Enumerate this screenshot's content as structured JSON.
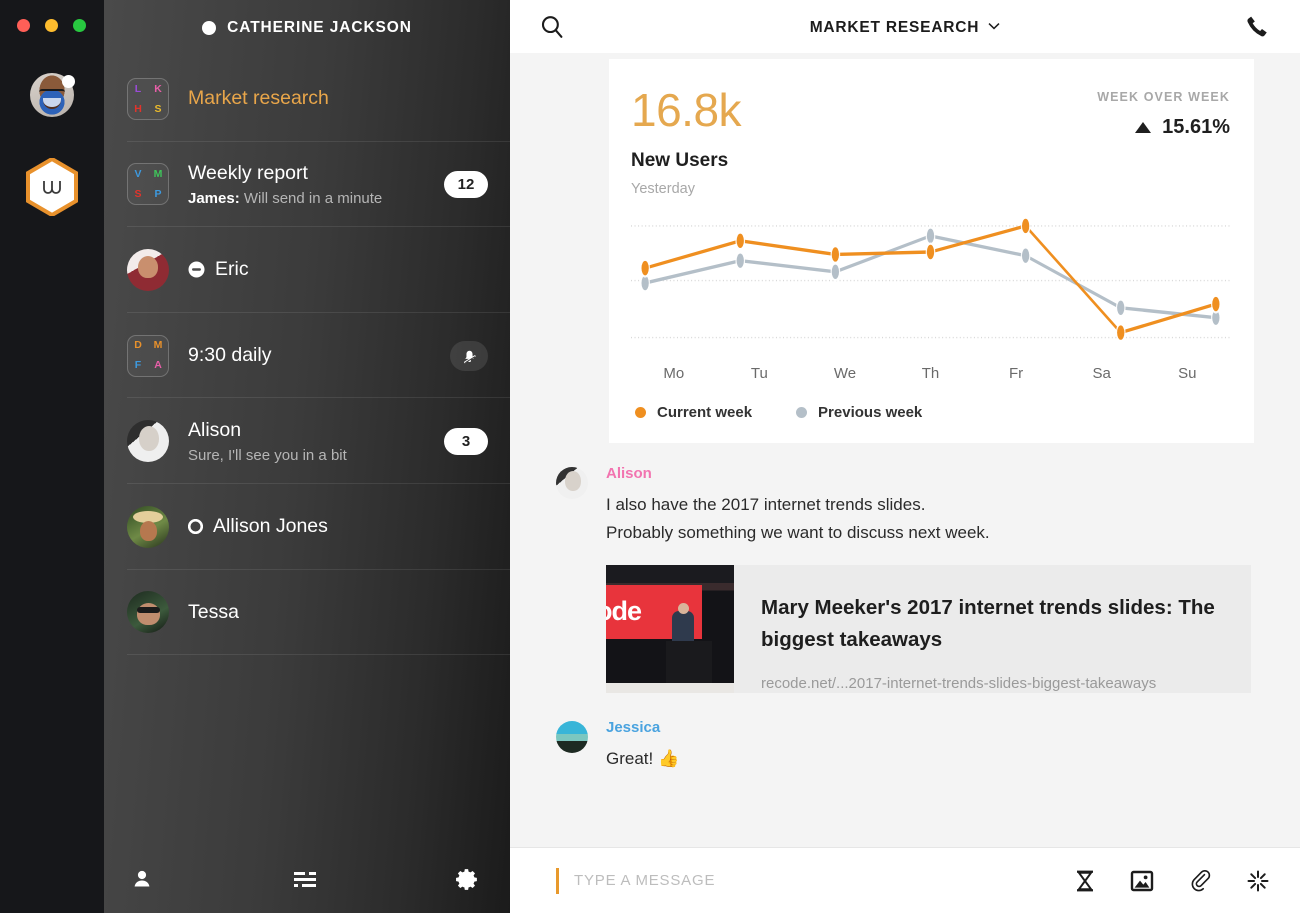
{
  "window": {
    "traffic_lights": [
      "close",
      "minimize",
      "zoom"
    ],
    "colors": {
      "close": "#ff5f57",
      "minimize": "#febc2e",
      "zoom": "#28c840"
    }
  },
  "rail": {
    "self_avatar_name": "self-avatar",
    "presence": "available",
    "app_logo": "wire-hexagon-logo",
    "logo_color": "#e8912c"
  },
  "sidebar": {
    "header": {
      "title": "CATHERINE JACKSON",
      "presence": "online"
    },
    "items": [
      {
        "name": "Market research",
        "type": "group",
        "active": true,
        "tile": [
          {
            "letter": "L",
            "color": "#9b4bd8"
          },
          {
            "letter": "K",
            "color": "#e85fa8"
          },
          {
            "letter": "H",
            "color": "#e0342c"
          },
          {
            "letter": "S",
            "color": "#e8b92c"
          }
        ],
        "preview": "",
        "badge": "",
        "status": ""
      },
      {
        "name": "Weekly report",
        "type": "group",
        "active": false,
        "tile": [
          {
            "letter": "V",
            "color": "#3d9ae0"
          },
          {
            "letter": "M",
            "color": "#3fc45a"
          },
          {
            "letter": "S",
            "color": "#e0342c"
          },
          {
            "letter": "P",
            "color": "#3d9ae0"
          }
        ],
        "preview_author": "James:",
        "preview": "Will send in a minute",
        "badge": "12",
        "status": ""
      },
      {
        "name": "Eric",
        "type": "person",
        "active": false,
        "avatar": "eric-avatar",
        "preview": "",
        "badge": "",
        "status": "do-not-disturb"
      },
      {
        "name": "9:30 daily",
        "type": "group",
        "active": false,
        "tile": [
          {
            "letter": "D",
            "color": "#e8912c"
          },
          {
            "letter": "M",
            "color": "#e8912c"
          },
          {
            "letter": "F",
            "color": "#3d9ae0"
          },
          {
            "letter": "A",
            "color": "#e85fa8"
          }
        ],
        "preview": "",
        "badge": "",
        "status": "",
        "muted": true
      },
      {
        "name": "Alison",
        "type": "person",
        "active": false,
        "avatar": "alison-avatar",
        "preview": "Sure, I'll see you in a bit",
        "badge": "3",
        "status": ""
      },
      {
        "name": "Allison Jones",
        "type": "person",
        "active": false,
        "avatar": "allison-jones-avatar",
        "preview": "",
        "badge": "",
        "status": "unread-ring"
      },
      {
        "name": "Tessa",
        "type": "person",
        "active": false,
        "avatar": "tessa-avatar",
        "preview": "",
        "badge": "",
        "status": ""
      }
    ],
    "footer": {
      "contacts_icon": "person-icon",
      "filters_icon": "sliders-icon",
      "settings_icon": "gear-icon"
    }
  },
  "main": {
    "header": {
      "search_icon": "search-icon",
      "title": "MARKET RESEARCH",
      "chevron": "chevron-down-icon",
      "call_icon": "phone-icon"
    },
    "card": {
      "kpi_value": "16.8k",
      "kpi_label": "New Users",
      "kpi_sub": "Yesterday",
      "delta_caption": "WEEK OVER WEEK",
      "delta_value": "15.61%",
      "delta_direction": "up",
      "accent_color": "#e5a84f"
    },
    "messages": [
      {
        "author": "Alison",
        "author_color": "#f274b0",
        "avatar": "alison-avatar",
        "lines": [
          "I also have the 2017 internet trends slides.",
          "Probably something we want to discuss next week."
        ],
        "link_preview": {
          "title": "Mary Meeker's 2017 internet trends slides: The biggest takeaways",
          "url": "recode.net/...2017-internet-trends-slides-biggest-takeaways",
          "thumb_text": "ode"
        }
      },
      {
        "author": "Jessica",
        "author_color": "#4aa3df",
        "avatar": "jessica-avatar",
        "lines": [
          "Great! 👍"
        ],
        "link_preview": null
      }
    ],
    "composer": {
      "placeholder": "TYPE A MESSAGE",
      "value": "",
      "icons": [
        "hourglass-icon",
        "image-icon",
        "paperclip-icon",
        "sparkle-icon"
      ]
    }
  },
  "chart_data": {
    "type": "line",
    "title": "New Users",
    "subtitle": "Yesterday",
    "xlabel": "",
    "ylabel": "",
    "categories": [
      "Mo",
      "Tu",
      "We",
      "Th",
      "Fr",
      "Sa",
      "Su"
    ],
    "tick_labels": [
      "Mo",
      "Tu",
      "We",
      "Th",
      "Fr",
      "Sa",
      "Su"
    ],
    "series": [
      {
        "name": "Current week",
        "color": "#ef8f20",
        "values": [
          62,
          84,
          73,
          75,
          96,
          10,
          33
        ]
      },
      {
        "name": "Previous week",
        "color": "#b4bfc8",
        "values": [
          50,
          68,
          59,
          88,
          72,
          30,
          22
        ]
      }
    ],
    "ylim": [
      0,
      100
    ],
    "gridlines": [
      6,
      52,
      96
    ],
    "grid": true,
    "grid_style": "dotted-horizontal",
    "legend_position": "bottom-left",
    "legend": [
      "Current week",
      "Previous week"
    ]
  }
}
